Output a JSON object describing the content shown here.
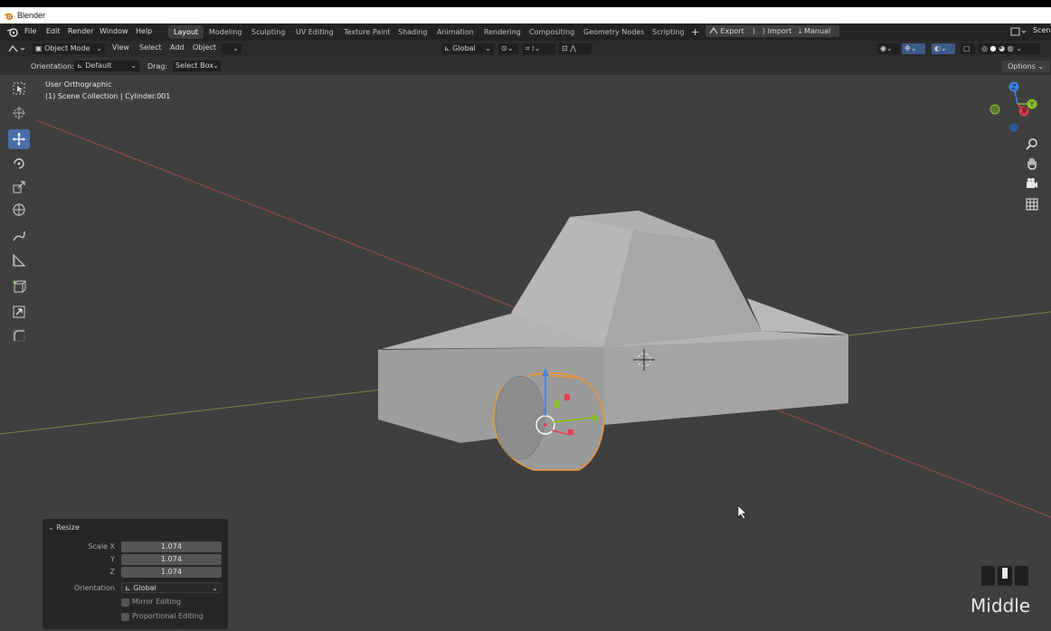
{
  "app": {
    "title": "Blender"
  },
  "menu": [
    "File",
    "Edit",
    "Render",
    "Window",
    "Help"
  ],
  "workspaces": {
    "active": "Layout",
    "tabs": [
      "Layout",
      "Modeling",
      "Sculpting",
      "UV Editing",
      "Texture Paint",
      "Shading",
      "Animation",
      "Rendering",
      "Compositing",
      "Geometry Nodes",
      "Scripting"
    ]
  },
  "topbar_buttons": {
    "export": "Export",
    "import": "Import",
    "manual": "Manual",
    "scene": "Scen"
  },
  "header": {
    "mode": "Object Mode",
    "view": "View",
    "select": "Select",
    "add": "Add",
    "object": "Object",
    "transform_orientation": "Global"
  },
  "tool_settings": {
    "orientation_label": "Orientation:",
    "orientation_value": "Default",
    "drag_label": "Drag:",
    "drag_value": "Select Box",
    "options": "Options"
  },
  "viewport": {
    "view_name": "User Orthographic",
    "collection_info": "(1) Scene Collection | Cylinder.001",
    "gizmo_axes": [
      "Z",
      "Y",
      "X"
    ]
  },
  "redo_panel": {
    "title": "Resize",
    "scale_x_label": "Scale X",
    "scale_y_label": "Y",
    "scale_z_label": "Z",
    "scale_x": "1.074",
    "scale_y": "1.074",
    "scale_z": "1.074",
    "orientation_label": "Orientation",
    "orientation_value": "Global",
    "mirror_editing": "Mirror Editing",
    "proportional_editing": "Proportional Editing"
  },
  "key_hint": "Middle",
  "colors": {
    "viewport_bg": "#3f3f3f",
    "active_tool": "#4a6fa8",
    "selection_outline": "#e8973a",
    "axis_x": "#b04a4a",
    "axis_y": "#7a8a3a",
    "gizmo_x": "#e0414f",
    "gizmo_y": "#8ac12a",
    "gizmo_z": "#3f86e0"
  }
}
